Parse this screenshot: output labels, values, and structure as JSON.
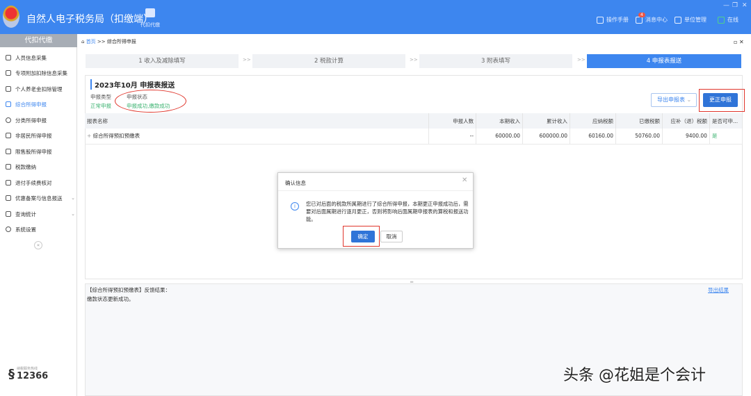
{
  "header": {
    "title": "自然人电子税务局（扣缴端）",
    "nav": "代扣代缴",
    "links": [
      "操作手册",
      "消息中心",
      "单位管理",
      "在线"
    ],
    "message_badge": "4"
  },
  "sidebar": {
    "title": "代扣代缴",
    "items": [
      {
        "label": "人员信息采集"
      },
      {
        "label": "专项附加扣除信息采集"
      },
      {
        "label": "个人养老金扣除管理"
      },
      {
        "label": "综合所得申报",
        "active": true
      },
      {
        "label": "分类所得申报"
      },
      {
        "label": "非居民所得申报"
      },
      {
        "label": "限售股所得申报"
      },
      {
        "label": "税款缴纳"
      },
      {
        "label": "退付手续费核对"
      },
      {
        "label": "优惠备案与信息报送",
        "expandable": true
      },
      {
        "label": "查询统计",
        "expandable": true
      },
      {
        "label": "系统设置"
      }
    ],
    "hotline": "12366",
    "hotline_label": "纳税服务热线"
  },
  "breadcrumb": {
    "home": "首页",
    "sep": ">>",
    "current": "综合所得申报"
  },
  "steps": [
    {
      "label": "1 收入及减除填写"
    },
    {
      "label": "2 税款计算"
    },
    {
      "label": "3 附表填写"
    },
    {
      "label": "4 申报表报送",
      "active": true
    }
  ],
  "step_sep": ">>",
  "main": {
    "title": "2023年10月  申报表报送",
    "type_label": "申报类型",
    "type_value": "正常申报",
    "status_label": "申报状态",
    "status_value": "申报成功,缴款成功",
    "export_label": "导出申报表",
    "correct_label": "更正申报"
  },
  "table": {
    "headers": [
      "报表名称",
      "申报人数",
      "本期收入",
      "累计收入",
      "应纳税额",
      "已缴税额",
      "应补（退）税额",
      "是否可申..."
    ],
    "rows": [
      [
        "综合所得预扣预缴表",
        "--",
        "60000.00",
        "600000.00",
        "60160.00",
        "50760.00",
        "9400.00",
        "是"
      ]
    ]
  },
  "dialog": {
    "title": "确认信息",
    "message": "您已对后面的税款所属期进行了综合所得申报，本期更正申报成功后，需要对后面属期进行逐月更正，否则将影响后面属期申报表的算税和报送功能。",
    "ok": "确定",
    "cancel": "取消"
  },
  "feedback": {
    "line1": "【综合所得预扣预缴表】反馈结果：",
    "line2": "缴款状态更新成功。",
    "export": "导出结果"
  },
  "watermark": "头条 @花姐是个会计",
  "colors": {
    "primary": "#3d86ef",
    "success": "#3cb371",
    "annotation": "#e0352b"
  }
}
